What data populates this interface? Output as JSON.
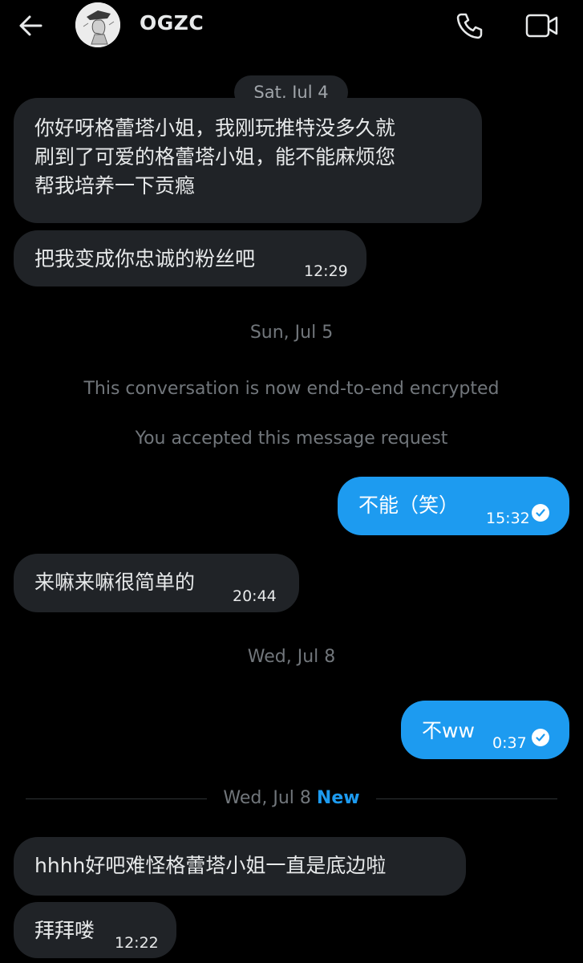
{
  "header": {
    "contact_name": "OGZC",
    "back_icon": "arrow-left-icon",
    "call_icon": "phone-icon",
    "video_icon": "video-camera-icon"
  },
  "colors": {
    "background": "#000000",
    "incoming_bubble": "#202327",
    "outgoing_bubble": "#1d9bf0",
    "new_label": "#1d9bf0",
    "muted_text": "#71767b"
  },
  "conversation": {
    "date_1": "Sat, Jul 4",
    "msg_1_line_1": "你好呀格蕾塔小姐，我刚玩推特没多久就",
    "msg_1_line_2": "刷到了可爱的格蕾塔小姐，能不能麻烦您",
    "msg_1_line_3": "帮我培养一下贡瘾",
    "msg_2_text": "把我变成你忠诚的粉丝吧",
    "msg_2_time": "12:29",
    "date_2": "Sun, Jul 5",
    "system_encrypted": "This conversation is now end-to-end encrypted",
    "system_accepted": "You accepted this message request",
    "msg_3_text": "不能（笑）",
    "msg_3_time": "15:32",
    "msg_4_text": "来嘛来嘛很简单的",
    "msg_4_time": "20:44",
    "date_3": "Wed, Jul 8",
    "msg_5_text": "不ww",
    "msg_5_time": "0:37",
    "date_4": "Wed, Jul 8",
    "new_label": "New",
    "msg_6_text": "hhhh好吧难怪格蕾塔小姐一直是底边啦",
    "msg_7_text": "拜拜喽",
    "msg_7_time": "12:22"
  }
}
